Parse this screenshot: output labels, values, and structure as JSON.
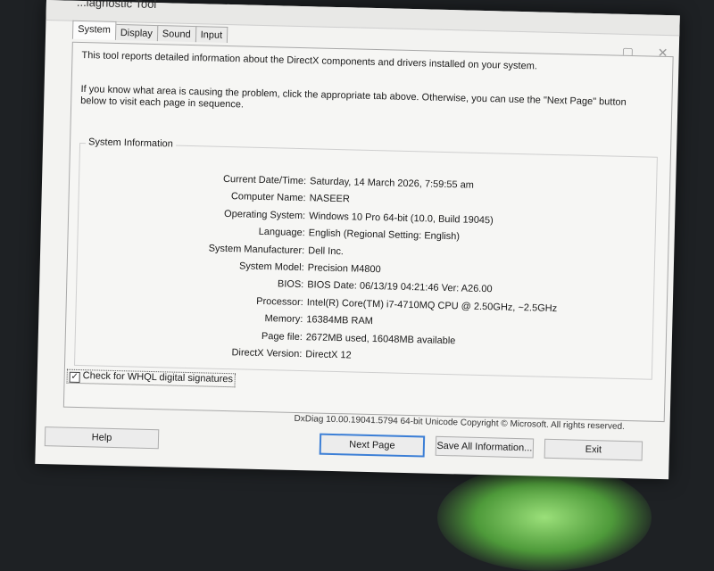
{
  "window": {
    "title": "DirectX Diagnostic Tool",
    "visible_title_fragment": "...iagnostic Tool"
  },
  "titlebar_icons": {
    "minimize": "minimize-icon",
    "close": "close-icon"
  },
  "tabs": [
    {
      "label": "System",
      "active": true
    },
    {
      "label": "Display",
      "active": false
    },
    {
      "label": "Sound",
      "active": false
    },
    {
      "label": "Input",
      "active": false
    }
  ],
  "intro": {
    "line1": "This tool reports detailed information about the DirectX components and drivers installed on your system.",
    "line2": "If you know what area is causing the problem, click the appropriate tab above.  Otherwise, you can use the \"Next Page\" button below to visit each page in sequence."
  },
  "system_info": {
    "title": "System Information",
    "rows": [
      {
        "label": "Current Date/Time:",
        "value": "Saturday, 14 March 2026, 7:59:55 am"
      },
      {
        "label": "Computer Name:",
        "value": "NASEER"
      },
      {
        "label": "Operating System:",
        "value": "Windows 10 Pro 64-bit (10.0, Build 19045)"
      },
      {
        "label": "Language:",
        "value": "English (Regional Setting: English)"
      },
      {
        "label": "System Manufacturer:",
        "value": "Dell Inc."
      },
      {
        "label": "System Model:",
        "value": "Precision M4800"
      },
      {
        "label": "BIOS:",
        "value": "BIOS Date: 06/13/19 04:21:46 Ver: A26.00"
      },
      {
        "label": "Processor:",
        "value": "Intel(R) Core(TM) i7-4710MQ CPU @ 2.50GHz, ~2.5GHz"
      },
      {
        "label": "Memory:",
        "value": "16384MB RAM"
      },
      {
        "label": "Page file:",
        "value": "2672MB used, 16048MB available"
      },
      {
        "label": "DirectX Version:",
        "value": "DirectX 12"
      }
    ]
  },
  "whql": {
    "label": "Check for WHQL digital signatures",
    "checked": true,
    "check_glyph": "✓"
  },
  "version_text": "DxDiag 10.00.19041.5794 64-bit Unicode  Copyright © Microsoft. All rights reserved.",
  "buttons": {
    "help": "Help",
    "next_page": "Next Page",
    "save_all": "Save All Information...",
    "exit": "Exit"
  }
}
